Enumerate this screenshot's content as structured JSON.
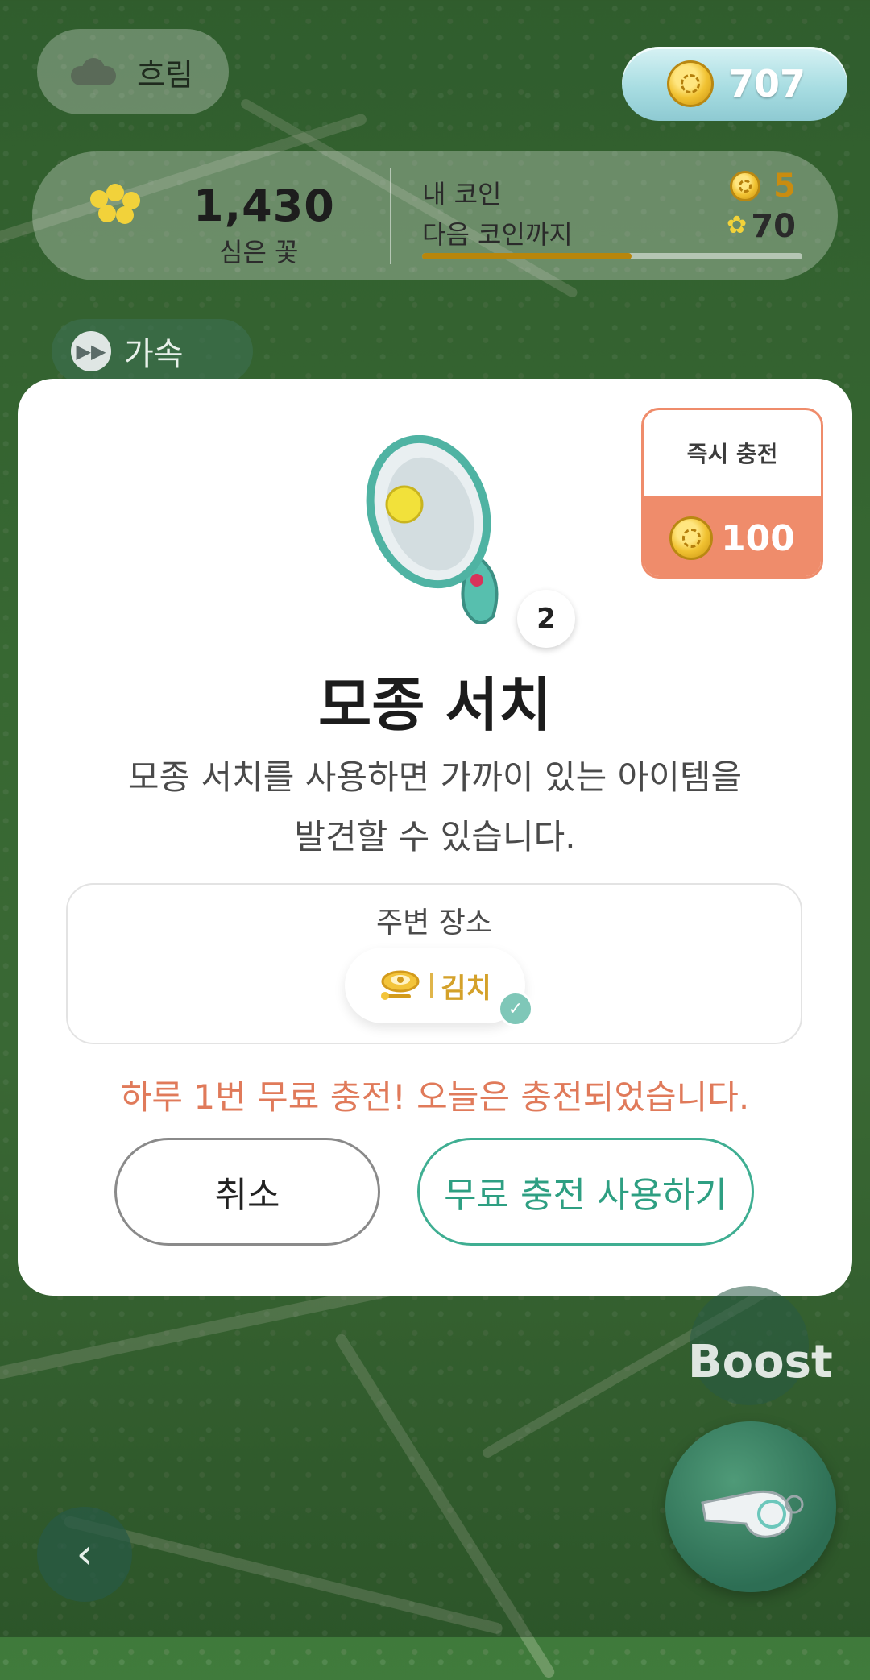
{
  "weather": {
    "label": "흐림",
    "icon": "cloud-icon"
  },
  "coins": {
    "balance": "707"
  },
  "stats": {
    "planted_count": "1,430",
    "planted_label": "심은 꽃",
    "my_coin_label": "내 코인",
    "my_coin_value": "5",
    "next_coin_label": "다음 코인까지",
    "next_coin_value": "70",
    "progress_fraction": 0.55
  },
  "speed": {
    "label": "가속"
  },
  "modal": {
    "instant_charge": {
      "label": "즉시 충전",
      "price": "100"
    },
    "item_count": "2",
    "title": "모종 서치",
    "description_line1": "모종 서치를 사용하면 가까이 있는 아이템을",
    "description_line2": "발견할 수 있습니다.",
    "nearby": {
      "title": "주변 장소",
      "place_name": "김치"
    },
    "notice": "하루 1번 무료 충전! 오늘은 충전되었습니다.",
    "cancel_label": "취소",
    "free_charge_label": "무료 충전 사용하기"
  },
  "boost": {
    "label": "Boost"
  },
  "colors": {
    "accent_orange": "#ef8c6b",
    "accent_green": "#3fae92",
    "coin_gold": "#f1c232"
  }
}
